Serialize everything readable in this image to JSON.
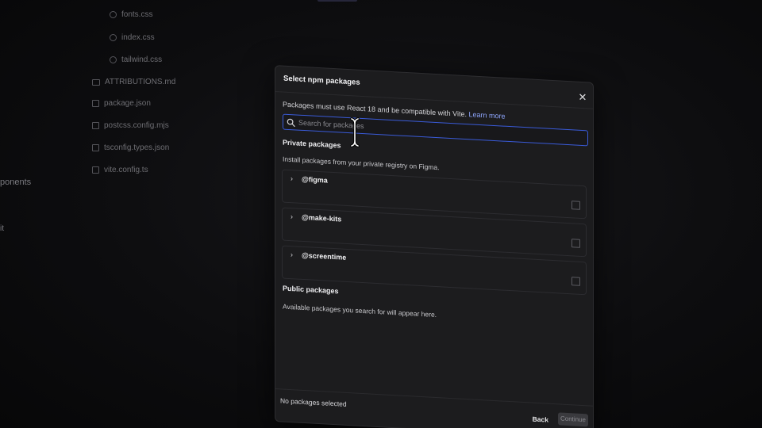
{
  "file_tree": {
    "items": [
      {
        "label": "fonts.css",
        "icon": "globe-icon"
      },
      {
        "label": "index.css",
        "icon": "globe-icon"
      },
      {
        "label": "tailwind.css",
        "icon": "globe-icon"
      },
      {
        "label": "ATTRIBUTIONS.md",
        "icon": "markdown-icon"
      },
      {
        "label": "package.json",
        "icon": "package-icon"
      },
      {
        "label": "postcss.config.mjs",
        "icon": "file-icon"
      },
      {
        "label": "tsconfig.types.json",
        "icon": "file-icon"
      },
      {
        "label": "vite.config.ts",
        "icon": "file-icon"
      }
    ],
    "side_labels": [
      "ponents",
      "it"
    ]
  },
  "dialog": {
    "title": "Select npm packages",
    "info_text": "Packages must use React 18 and be compatible with Vite.",
    "info_link": "Learn more",
    "search": {
      "placeholder": "Search for packages",
      "value": ""
    },
    "private": {
      "title": "Private packages",
      "description": "Install packages from your private registry on Figma.",
      "packages": [
        {
          "name": "@figma",
          "checked": false
        },
        {
          "name": "@make-kits",
          "checked": false
        },
        {
          "name": "@screentime",
          "checked": false
        }
      ]
    },
    "public": {
      "title": "Public packages",
      "description": "Available packages you search for will appear here."
    },
    "footer": {
      "status": "No packages selected",
      "back_label": "Back",
      "continue_label": "Continue"
    }
  },
  "colors": {
    "accent_border": "#3a5bd9",
    "link": "#8fa7ff",
    "dialog_bg": "#1c1c1e"
  }
}
